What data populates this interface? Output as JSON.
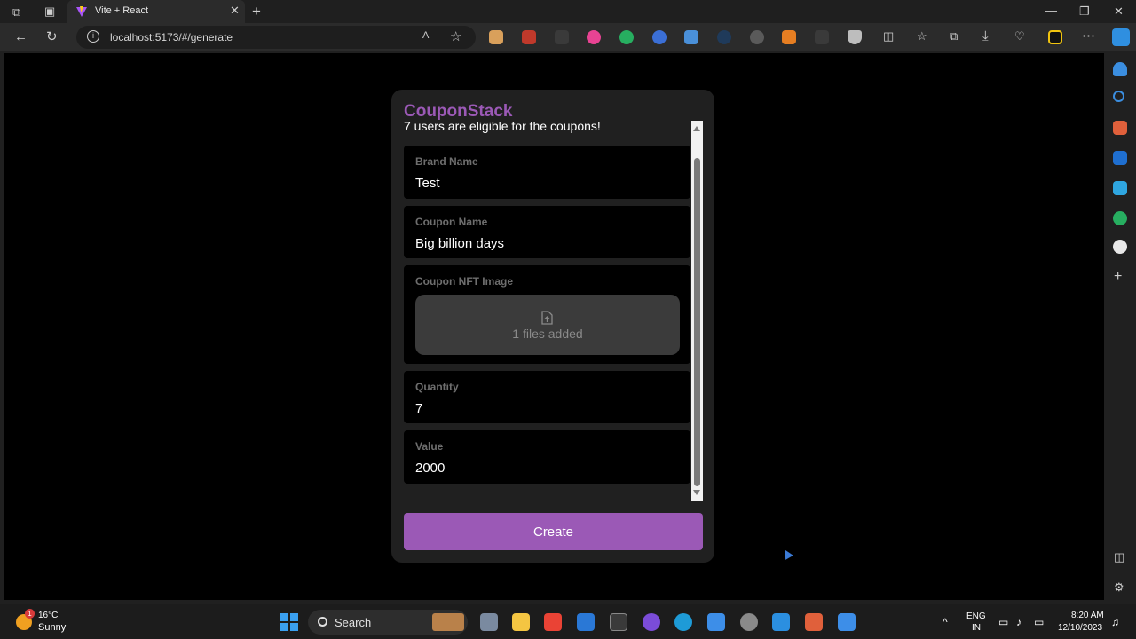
{
  "browser": {
    "tab_title": "Vite + React",
    "url": "localhost:5173/#/generate",
    "close_glyph": "✕",
    "new_tab_glyph": "+"
  },
  "app": {
    "brand": "CouponStack",
    "eligible_text": "7 users are eligible for the coupons!",
    "fields": {
      "brand_name": {
        "label": "Brand Name",
        "value": "Test"
      },
      "coupon_name": {
        "label": "Coupon Name",
        "value": "Big billion days"
      },
      "nft_image": {
        "label": "Coupon NFT Image",
        "status": "1 files added"
      },
      "quantity": {
        "label": "Quantity",
        "value": "7"
      },
      "value": {
        "label": "Value",
        "value": "2000"
      }
    },
    "create_label": "Create",
    "accent_color": "#9b59b6"
  },
  "taskbar": {
    "weather_temp": "16°C",
    "weather_cond": "Sunny",
    "weather_badge": "1",
    "search_label": "Search",
    "lang_line1": "ENG",
    "lang_line2": "IN",
    "time": "8:20 AM",
    "date": "12/10/2023"
  }
}
